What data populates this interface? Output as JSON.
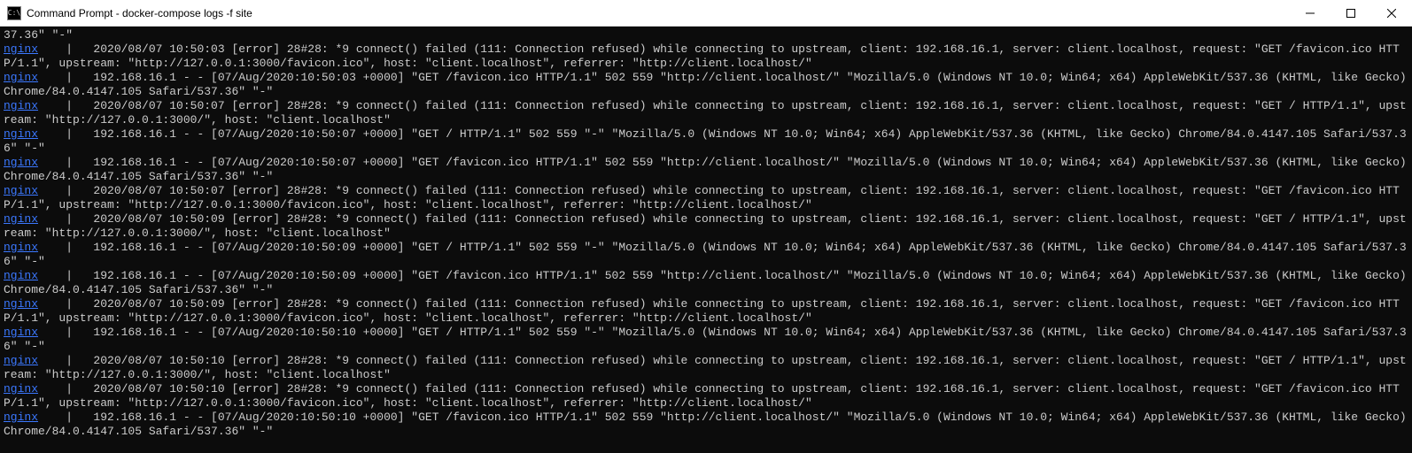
{
  "titlebar": {
    "icon_label": "C:\\",
    "title": "Command Prompt - docker-compose  logs -f site"
  },
  "terminal": {
    "service_label": "nginx",
    "separator": "    | ",
    "lines": [
      {
        "prefix": false,
        "text": "37.36\" \"-\""
      },
      {
        "prefix": true,
        "text": "  2020/08/07 10:50:03 [error] 28#28: *9 connect() failed (111: Connection refused) while connecting to upstream, client: 192.168.16.1, server: client.localhost, request: \"GET /favicon.ico HTTP/1.1\", upstream: \"http://127.0.0.1:3000/favicon.ico\", host: \"client.localhost\", referrer: \"http://client.localhost/\""
      },
      {
        "prefix": true,
        "text": "  192.168.16.1 - - [07/Aug/2020:10:50:03 +0000] \"GET /favicon.ico HTTP/1.1\" 502 559 \"http://client.localhost/\" \"Mozilla/5.0 (Windows NT 10.0; Win64; x64) AppleWebKit/537.36 (KHTML, like Gecko) Chrome/84.0.4147.105 Safari/537.36\" \"-\""
      },
      {
        "prefix": true,
        "text": "  2020/08/07 10:50:07 [error] 28#28: *9 connect() failed (111: Connection refused) while connecting to upstream, client: 192.168.16.1, server: client.localhost, request: \"GET / HTTP/1.1\", upstream: \"http://127.0.0.1:3000/\", host: \"client.localhost\""
      },
      {
        "prefix": true,
        "text": "  192.168.16.1 - - [07/Aug/2020:10:50:07 +0000] \"GET / HTTP/1.1\" 502 559 \"-\" \"Mozilla/5.0 (Windows NT 10.0; Win64; x64) AppleWebKit/537.36 (KHTML, like Gecko) Chrome/84.0.4147.105 Safari/537.36\" \"-\""
      },
      {
        "prefix": true,
        "text": "  192.168.16.1 - - [07/Aug/2020:10:50:07 +0000] \"GET /favicon.ico HTTP/1.1\" 502 559 \"http://client.localhost/\" \"Mozilla/5.0 (Windows NT 10.0; Win64; x64) AppleWebKit/537.36 (KHTML, like Gecko) Chrome/84.0.4147.105 Safari/537.36\" \"-\""
      },
      {
        "prefix": true,
        "text": "  2020/08/07 10:50:07 [error] 28#28: *9 connect() failed (111: Connection refused) while connecting to upstream, client: 192.168.16.1, server: client.localhost, request: \"GET /favicon.ico HTTP/1.1\", upstream: \"http://127.0.0.1:3000/favicon.ico\", host: \"client.localhost\", referrer: \"http://client.localhost/\""
      },
      {
        "prefix": true,
        "text": "  2020/08/07 10:50:09 [error] 28#28: *9 connect() failed (111: Connection refused) while connecting to upstream, client: 192.168.16.1, server: client.localhost, request: \"GET / HTTP/1.1\", upstream: \"http://127.0.0.1:3000/\", host: \"client.localhost\""
      },
      {
        "prefix": true,
        "text": "  192.168.16.1 - - [07/Aug/2020:10:50:09 +0000] \"GET / HTTP/1.1\" 502 559 \"-\" \"Mozilla/5.0 (Windows NT 10.0; Win64; x64) AppleWebKit/537.36 (KHTML, like Gecko) Chrome/84.0.4147.105 Safari/537.36\" \"-\""
      },
      {
        "prefix": true,
        "text": "  192.168.16.1 - - [07/Aug/2020:10:50:09 +0000] \"GET /favicon.ico HTTP/1.1\" 502 559 \"http://client.localhost/\" \"Mozilla/5.0 (Windows NT 10.0; Win64; x64) AppleWebKit/537.36 (KHTML, like Gecko) Chrome/84.0.4147.105 Safari/537.36\" \"-\""
      },
      {
        "prefix": true,
        "text": "  2020/08/07 10:50:09 [error] 28#28: *9 connect() failed (111: Connection refused) while connecting to upstream, client: 192.168.16.1, server: client.localhost, request: \"GET /favicon.ico HTTP/1.1\", upstream: \"http://127.0.0.1:3000/favicon.ico\", host: \"client.localhost\", referrer: \"http://client.localhost/\""
      },
      {
        "prefix": true,
        "text": "  192.168.16.1 - - [07/Aug/2020:10:50:10 +0000] \"GET / HTTP/1.1\" 502 559 \"-\" \"Mozilla/5.0 (Windows NT 10.0; Win64; x64) AppleWebKit/537.36 (KHTML, like Gecko) Chrome/84.0.4147.105 Safari/537.36\" \"-\""
      },
      {
        "prefix": true,
        "text": "  2020/08/07 10:50:10 [error] 28#28: *9 connect() failed (111: Connection refused) while connecting to upstream, client: 192.168.16.1, server: client.localhost, request: \"GET / HTTP/1.1\", upstream: \"http://127.0.0.1:3000/\", host: \"client.localhost\""
      },
      {
        "prefix": true,
        "text": "  2020/08/07 10:50:10 [error] 28#28: *9 connect() failed (111: Connection refused) while connecting to upstream, client: 192.168.16.1, server: client.localhost, request: \"GET /favicon.ico HTTP/1.1\", upstream: \"http://127.0.0.1:3000/favicon.ico\", host: \"client.localhost\", referrer: \"http://client.localhost/\""
      },
      {
        "prefix": true,
        "text": "  192.168.16.1 - - [07/Aug/2020:10:50:10 +0000] \"GET /favicon.ico HTTP/1.1\" 502 559 \"http://client.localhost/\" \"Mozilla/5.0 (Windows NT 10.0; Win64; x64) AppleWebKit/537.36 (KHTML, like Gecko) Chrome/84.0.4147.105 Safari/537.36\" \"-\""
      }
    ]
  }
}
